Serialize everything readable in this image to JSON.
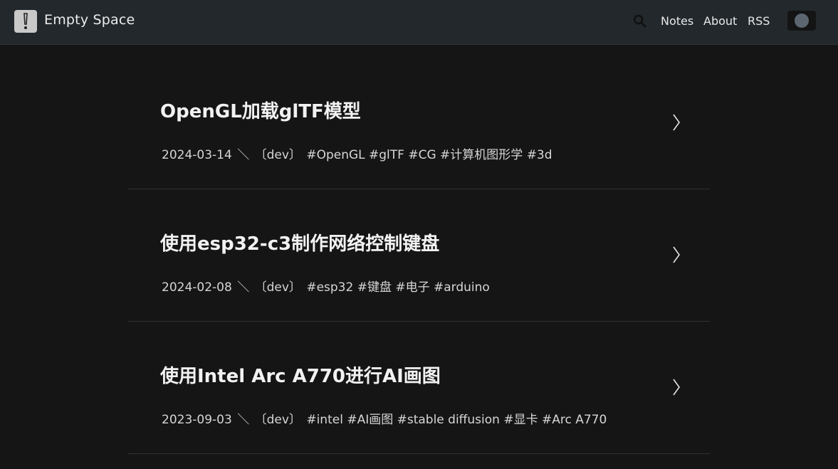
{
  "header": {
    "site_title": "Empty Space",
    "logo_icon": "exclamation-icon",
    "nav": {
      "notes": "Notes",
      "about": "About",
      "rss": "RSS"
    },
    "search_icon": "search-icon",
    "theme_toggle_icon": "theme-toggle-icon"
  },
  "posts": [
    {
      "title": "OpenGL加载glTF模型",
      "date": "2024-03-14",
      "separator": "＼",
      "category": "〔dev〕",
      "tags": "#OpenGL #glTF #CG #计算机图形学 #3d"
    },
    {
      "title": "使用esp32-c3制作网络控制键盘",
      "date": "2024-02-08",
      "separator": "＼",
      "category": "〔dev〕",
      "tags": "#esp32 #键盘 #电子 #arduino"
    },
    {
      "title": "使用Intel Arc A770进行AI画图",
      "date": "2023-09-03",
      "separator": "＼",
      "category": "〔dev〕",
      "tags": "#intel #AI画图 #stable diffusion #显卡 #Arc A770"
    }
  ],
  "colors": {
    "background": "#151515",
    "header": "#23282c",
    "divider": "#303030"
  }
}
